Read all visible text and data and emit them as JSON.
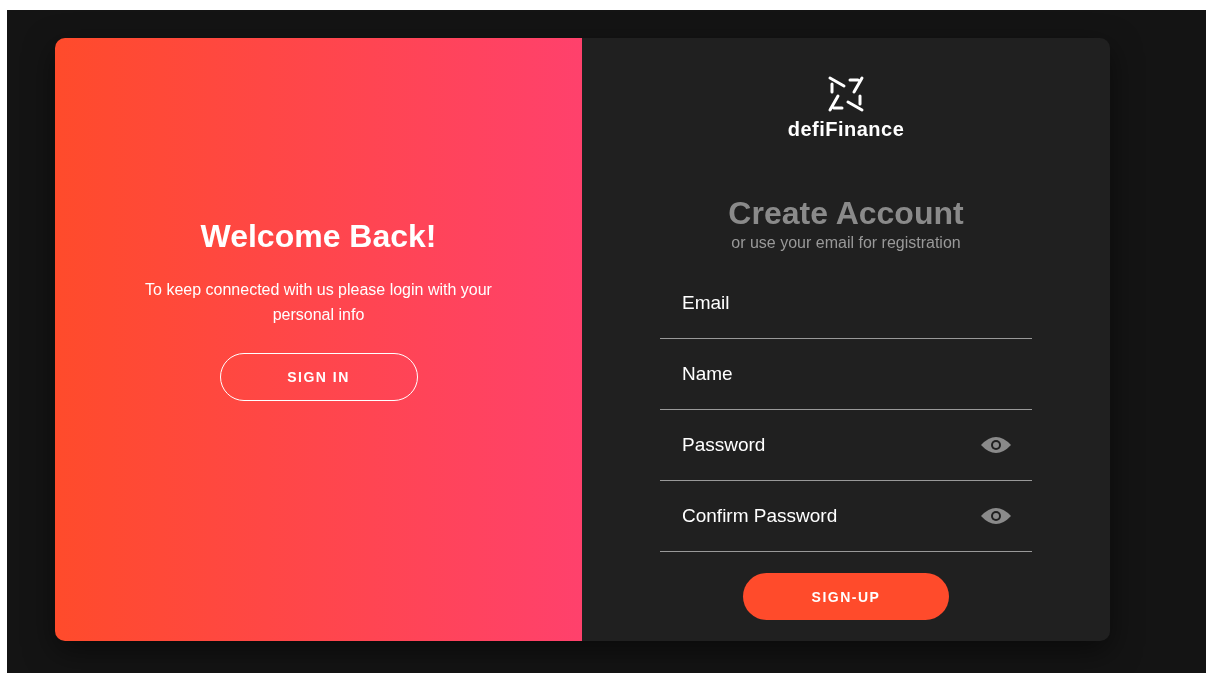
{
  "overlay_panel": {
    "title": "Welcome Back!",
    "message": "To keep connected with us please login with your personal info",
    "button": "SIGN IN"
  },
  "form": {
    "brand": "defiFinance",
    "title": "Create Account",
    "subtitle": "or use your email for registration",
    "fields": [
      {
        "placeholder": "Email",
        "kind": "text"
      },
      {
        "placeholder": "Name",
        "kind": "text"
      },
      {
        "placeholder": "Password",
        "kind": "password"
      },
      {
        "placeholder": "Confirm Password",
        "kind": "password"
      }
    ],
    "submit": "SIGN-UP"
  }
}
